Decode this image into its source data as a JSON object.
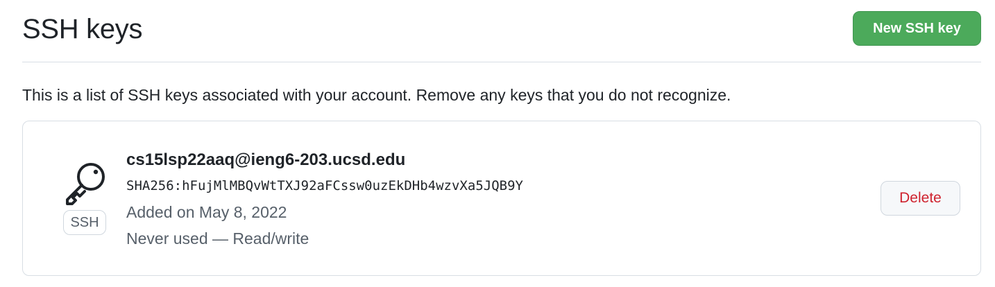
{
  "header": {
    "title": "SSH keys",
    "new_key_label": "New SSH key"
  },
  "description": "This is a list of SSH keys associated with your account. Remove any keys that you do not recognize.",
  "keys": [
    {
      "icon": "key-icon",
      "type": "SSH",
      "title": "cs15lsp22aaq@ieng6-203.ucsd.edu",
      "fingerprint": "SHA256:hFujMlMBQvWtTXJ92aFCssw0uzEkDHb4wzvXa5JQB9Y",
      "added": "Added on May 8, 2022",
      "usage": "Never used — Read/write",
      "delete_label": "Delete"
    }
  ],
  "colors": {
    "primary_button": "#4caa5b",
    "danger_text": "#cf222e",
    "muted_text": "#57606a",
    "border": "#d8dee4"
  }
}
